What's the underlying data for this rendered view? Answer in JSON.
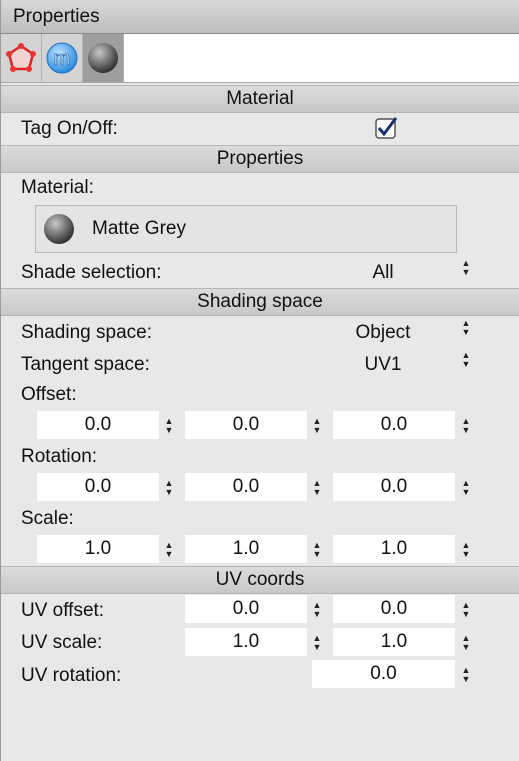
{
  "window": {
    "title": "Properties"
  },
  "tabs": [
    {
      "name": "polygon-tag-icon"
    },
    {
      "name": "material-m-icon"
    },
    {
      "name": "sphere-icon"
    }
  ],
  "sections": {
    "material": "Material",
    "properties": "Properties",
    "shading_space": "Shading space",
    "uv_coords": "UV coords"
  },
  "tag": {
    "label": "Tag On/Off:",
    "checked": true
  },
  "material": {
    "label": "Material:",
    "name": "Matte Grey"
  },
  "shade_selection": {
    "label": "Shade selection:",
    "value": "All"
  },
  "shading": {
    "shading_space_label": "Shading space:",
    "shading_space_value": "Object",
    "tangent_space_label": "Tangent space:",
    "tangent_space_value": "UV1"
  },
  "offset": {
    "label": "Offset:",
    "values": [
      "0.0",
      "0.0",
      "0.0"
    ]
  },
  "rotation": {
    "label": "Rotation:",
    "values": [
      "0.0",
      "0.0",
      "0.0"
    ]
  },
  "scale": {
    "label": "Scale:",
    "values": [
      "1.0",
      "1.0",
      "1.0"
    ]
  },
  "uv": {
    "offset_label": "UV offset:",
    "offset_values": [
      "0.0",
      "0.0"
    ],
    "scale_label": "UV scale:",
    "scale_values": [
      "1.0",
      "1.0"
    ],
    "rotation_label": "UV rotation:",
    "rotation_value": "0.0"
  }
}
